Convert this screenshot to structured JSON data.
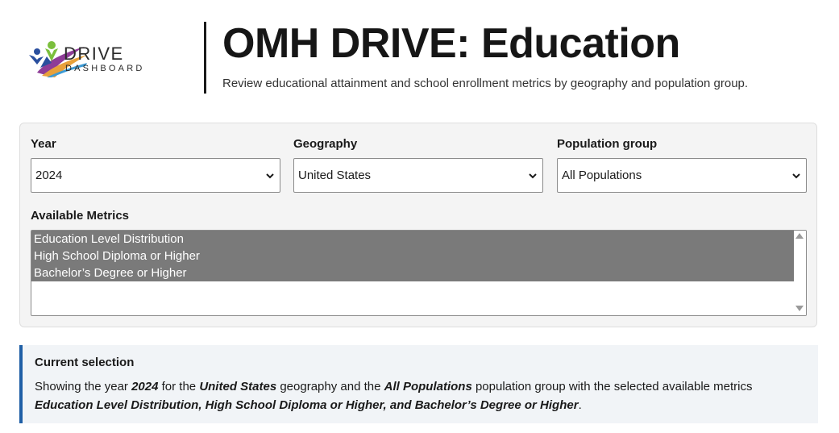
{
  "header": {
    "logo": {
      "word1": "DRIVE",
      "word2": "DASHBOARD"
    },
    "title": "OMH DRIVE: Education",
    "subtitle": "Review educational attainment and school enrollment metrics by geography and population group."
  },
  "filters": {
    "year": {
      "label": "Year",
      "value": "2024"
    },
    "geography": {
      "label": "Geography",
      "value": "United States"
    },
    "population": {
      "label": "Population group",
      "value": "All Populations"
    },
    "metrics": {
      "label": "Available Metrics",
      "options": [
        "Education Level Distribution",
        "High School Diploma or Higher",
        "Bachelor’s Degree or Higher"
      ]
    }
  },
  "current": {
    "title": "Current selection",
    "t1": "Showing the year ",
    "year": "2024",
    "t2": " for the ",
    "geography": "United States",
    "t3": " geography and the ",
    "population": "All Populations",
    "t4": " population group with the selected available metrics ",
    "metrics": "Education Level Distribution, High School Diploma or Higher, and Bachelor’s Degree or Higher",
    "t5": "."
  },
  "colors": {
    "accent": "#1f5fa6",
    "selected_option": "#7a7a7a",
    "panel": "#f4f4f4"
  },
  "icons": [
    "drive-logo-icon",
    "chevron-down-icon",
    "scroll-up-icon",
    "scroll-down-icon"
  ]
}
